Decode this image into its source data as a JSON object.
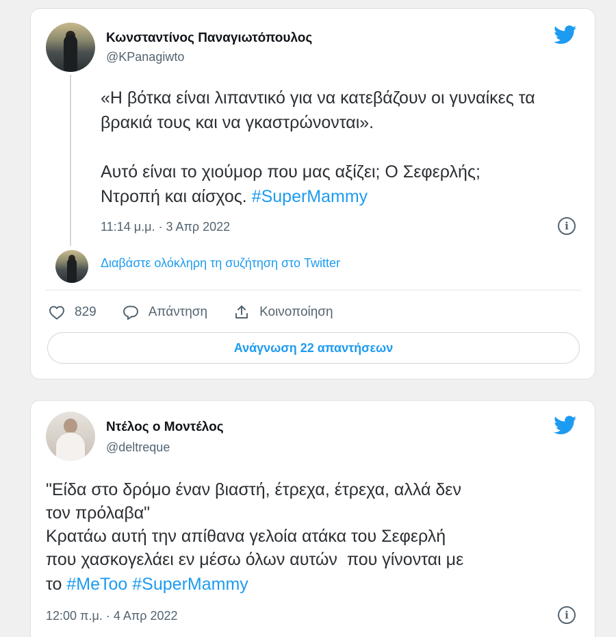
{
  "tweets": [
    {
      "author_name": "Κωνσταντίνος Παναγιωτόπουλος",
      "handle": "@KPanagiwto",
      "text_quote": "«Η βότκα είναι λιπαντικό για να κατεβάζουν οι γυναίκες τα βρακιά τους και να γκαστρώνονται».",
      "text_line3": "Αυτό είναι το χιούμορ που μας αξίζει; Ο Σεφερλής;",
      "text_line4": "Ντροπή και αίσχος. ",
      "hashtag": "#SuperMammy",
      "timestamp": "11:14 μ.μ. · 3 Απρ 2022",
      "read_thread": "Διαβάστε ολόκληρη τη συζήτηση στο Twitter",
      "likes": "829",
      "reply_label": "Απάντηση",
      "share_label": "Κοινοποίηση",
      "read_replies": "Ανάγνωση 22 απαντήσεων"
    },
    {
      "author_name": "Ντέλος ο Μοντέλος",
      "handle": "@deltreque",
      "text_line1": "\"Είδα στο δρόμο έναν βιαστή, έτρεχα, έτρεχα, αλλά δεν",
      "text_line2": "τον πρόλαβα\"",
      "text_line3": "Κρατάω αυτή την απίθανα γελοία ατάκα του Σεφερλή",
      "text_line4": "που χασκογελάει εν μέσω όλων αυτών  που γίνονται με",
      "text_line5_prefix": "το ",
      "hashtag1": "#MeToo",
      "hashtag2": "#SuperMammy",
      "timestamp": "12:00 π.μ. · 4 Απρ 2022"
    }
  ],
  "icons": {
    "brand": "twitter-bird-icon",
    "info": "info-icon",
    "like": "heart-icon",
    "reply": "speech-bubble-icon",
    "share": "share-upload-icon"
  },
  "info_glyph": "i",
  "colors": {
    "accent": "#1d9bf0",
    "muted": "#536471",
    "text": "#0f1419"
  }
}
